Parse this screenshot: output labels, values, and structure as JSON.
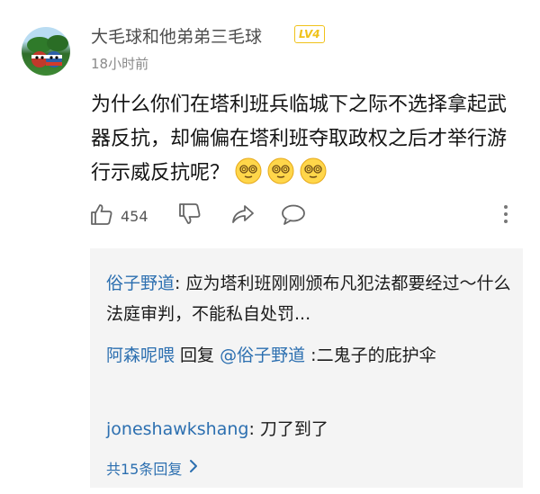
{
  "comment": {
    "username": "大毛球和他弟弟三毛球",
    "level": "LV4",
    "time": "18小时前",
    "text": "为什么你们在塔利班兵临城下之际不选择拿起武器反抗，却偏偏在塔利班夺取政权之后才举行游行示威反抗呢？",
    "emojis": [
      "dizzy-face-icon",
      "dizzy-face-icon",
      "dizzy-face-icon"
    ]
  },
  "actions": {
    "like_count": "454",
    "icons": [
      "thumbs-up-icon",
      "thumbs-down-icon",
      "share-icon",
      "comment-icon",
      "more-vertical-icon"
    ]
  },
  "replies": [
    {
      "user": "俗子野道",
      "separator": ": ",
      "text": "应为塔利班刚刚颁布凡犯法都要经过～什么法庭审判，不能私自处罚..."
    },
    {
      "user": "阿森呢喂",
      "mid": " 回复 ",
      "reply_to": "@俗子野道",
      "separator": " :",
      "text": "二鬼子的庇护伞"
    },
    {
      "user": "joneshawkshang",
      "separator": ": ",
      "text": "刀了到了"
    }
  ],
  "more_replies": "共15条回复",
  "colors": {
    "link": "#2c6fb0",
    "badge": "#f0c21a",
    "reply_bg": "#f4f4f4"
  }
}
